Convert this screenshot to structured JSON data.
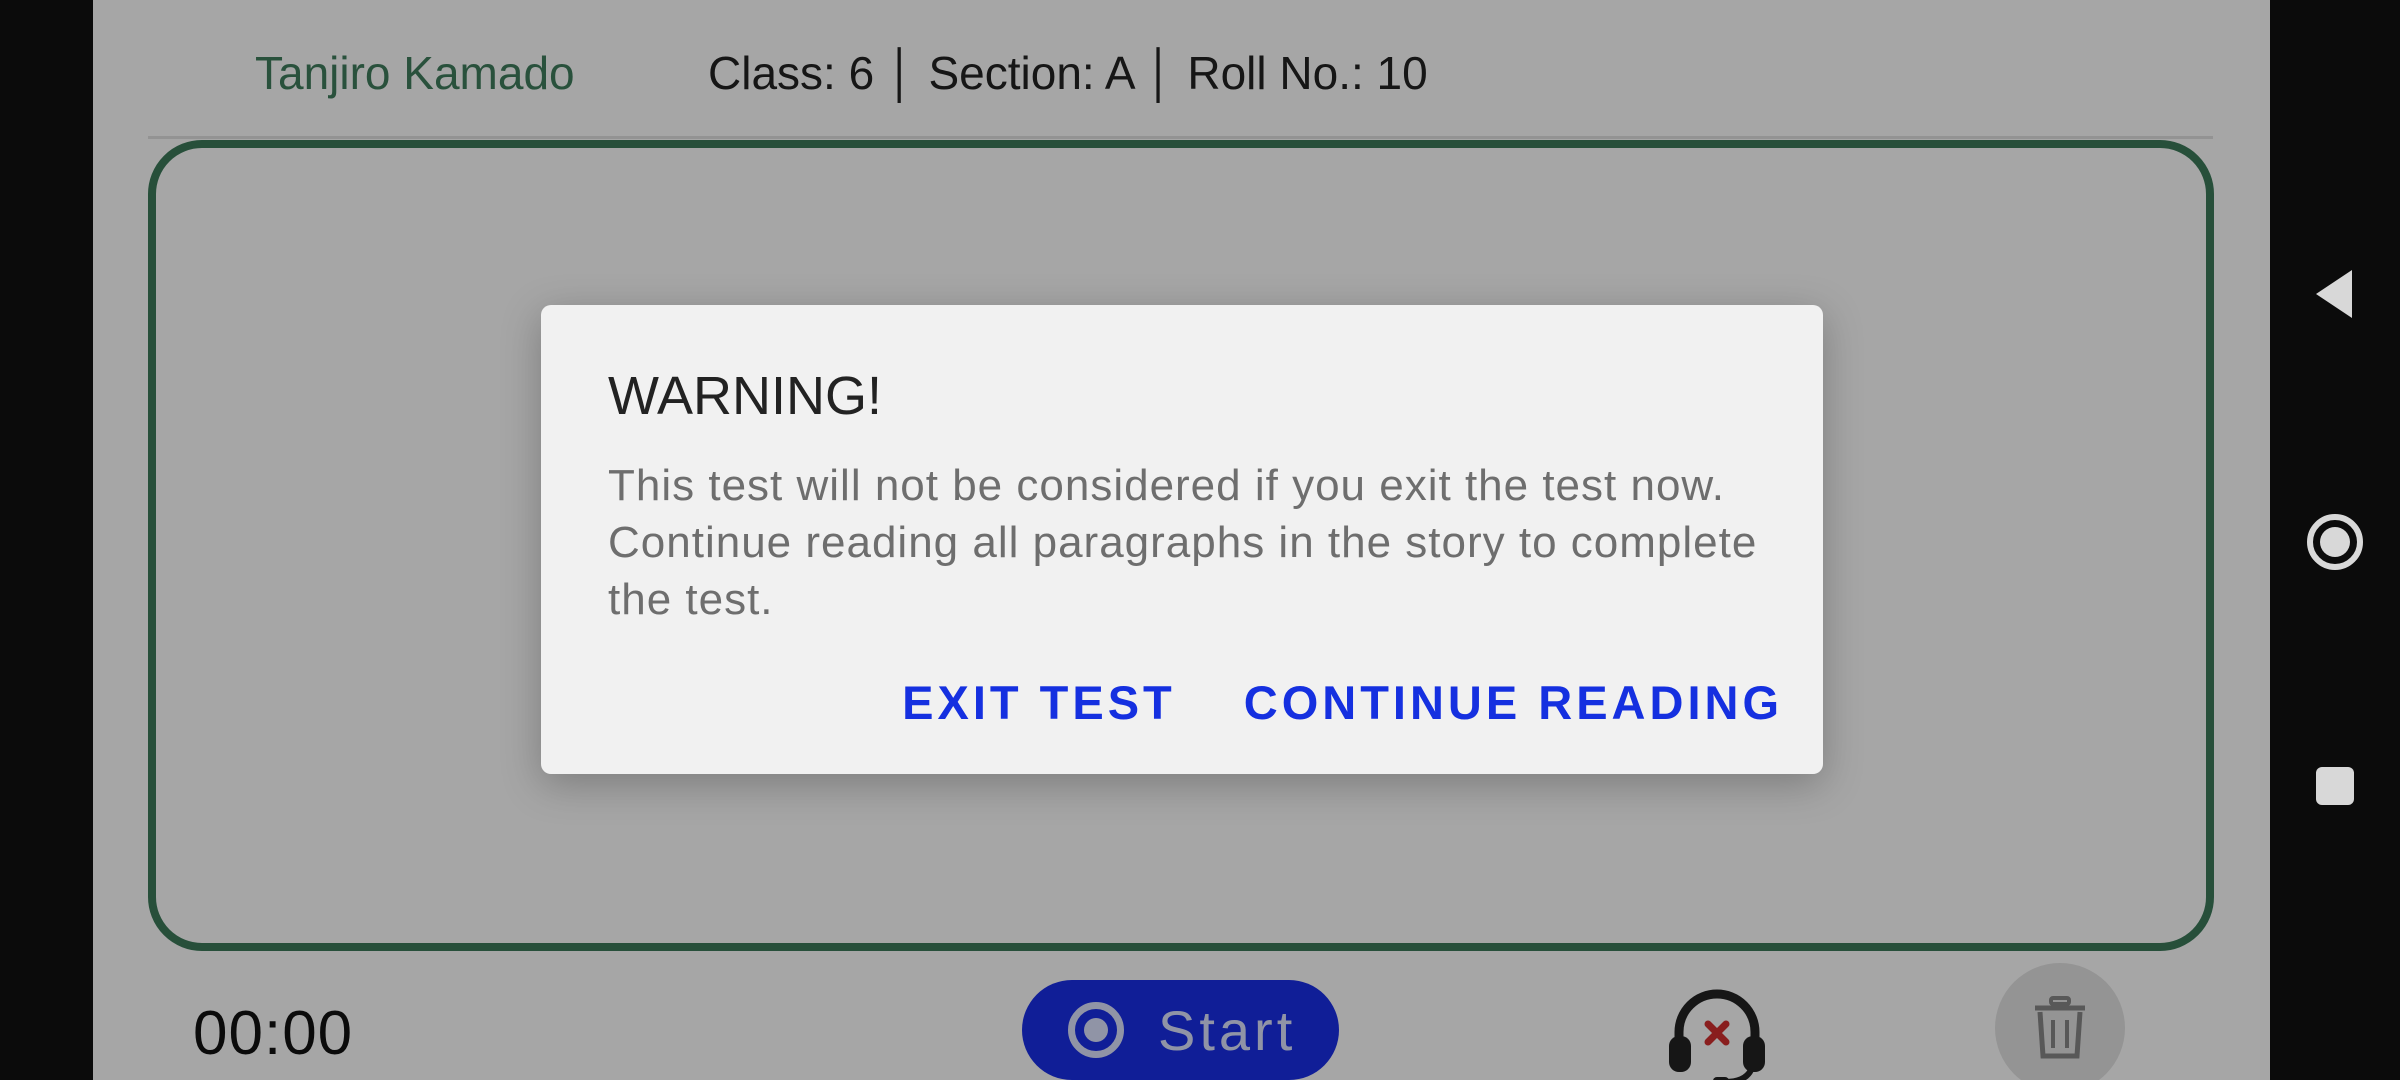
{
  "header": {
    "student_name": "Tanjiro Kamado",
    "student_info": "Class: 6 │ Section: A │ Roll No.: 10"
  },
  "footer": {
    "timer": "00:00",
    "start_label": "Start"
  },
  "dialog": {
    "title": "WARNING!",
    "message": "This test will not be considered if you exit the test now. Continue reading all paragraphs in the story to complete the test.",
    "exit_label": "EXIT TEST",
    "continue_label": "CONTINUE READING"
  },
  "icons": {
    "record": "record-icon",
    "headset_disabled": "headset-off-icon",
    "trash": "trash-icon",
    "back": "back-triangle-icon",
    "home": "home-circle-icon",
    "recents": "recents-square-icon"
  },
  "colors": {
    "brand_green": "#3c7a5a",
    "accent_blue": "#1a2ee8",
    "dialog_button_blue": "#1530e0",
    "error_red": "#d32f2f"
  }
}
